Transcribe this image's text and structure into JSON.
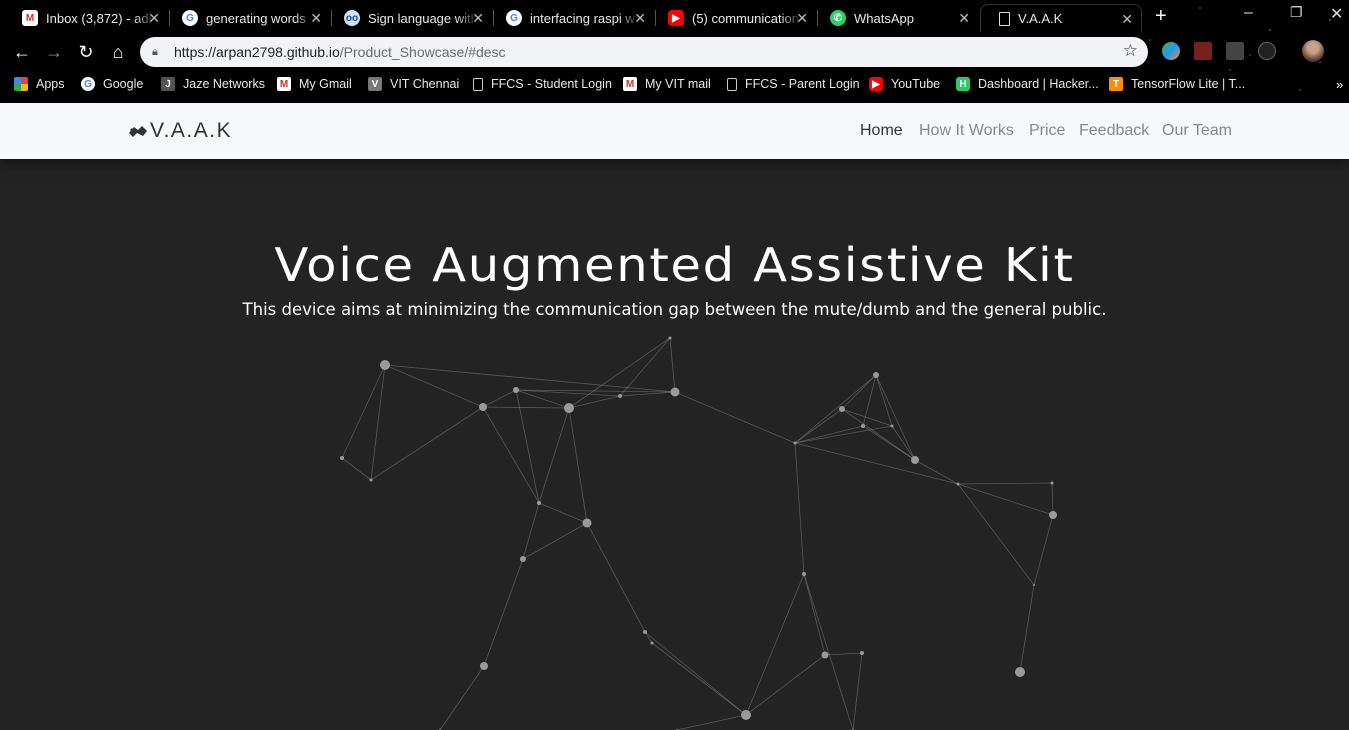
{
  "browser": {
    "tabs": [
      {
        "title": "Inbox (3,872) - adi",
        "icon": "gmail-icon"
      },
      {
        "title": "generating words",
        "icon": "google-icon"
      },
      {
        "title": "Sign language with",
        "icon": "glasses-icon"
      },
      {
        "title": "interfacing raspi w",
        "icon": "google-icon"
      },
      {
        "title": "(5) communication",
        "icon": "youtube-icon"
      },
      {
        "title": "WhatsApp",
        "icon": "whatsapp-icon"
      },
      {
        "title": "V.A.A.K",
        "icon": "document-icon"
      }
    ],
    "url_prefix": "https://arpan2798.github.io",
    "url_path": "/Product_Showcase/#desc",
    "bookmarks": [
      {
        "label": "Apps",
        "icon": "apps-grid-icon"
      },
      {
        "label": "Google",
        "icon": "google-icon"
      },
      {
        "label": "Jaze Networks",
        "icon": "jaze-icon"
      },
      {
        "label": "My Gmail",
        "icon": "gmail-icon"
      },
      {
        "label": "VIT Chennai",
        "icon": "vit-icon"
      },
      {
        "label": "FFCS - Student Login",
        "icon": "document-icon"
      },
      {
        "label": "My VIT mail",
        "icon": "gmail-icon"
      },
      {
        "label": "FFCS - Parent Login",
        "icon": "document-icon"
      },
      {
        "label": "YouTube",
        "icon": "youtube-icon"
      },
      {
        "label": "Dashboard | Hacker...",
        "icon": "hackerrank-icon"
      },
      {
        "label": "TensorFlow Lite | T...",
        "icon": "tensorflow-icon"
      }
    ]
  },
  "site": {
    "brand": "V.A.A.K",
    "nav": [
      {
        "label": "Home",
        "active": true
      },
      {
        "label": "How It Works",
        "active": false
      },
      {
        "label": "Price",
        "active": false
      },
      {
        "label": "Feedback",
        "active": false
      },
      {
        "label": "Our Team",
        "active": false
      }
    ],
    "hero_title": "Voice Augmented Assistive Kit",
    "hero_subtitle": "This device aims at minimizing the communication gap between the mute/dumb and the general public."
  },
  "colors": {
    "page_bg": "#232323",
    "navbar_bg": "#f8f9fa",
    "particle": "#9a9a9a",
    "chrome_bg": "#000000"
  }
}
